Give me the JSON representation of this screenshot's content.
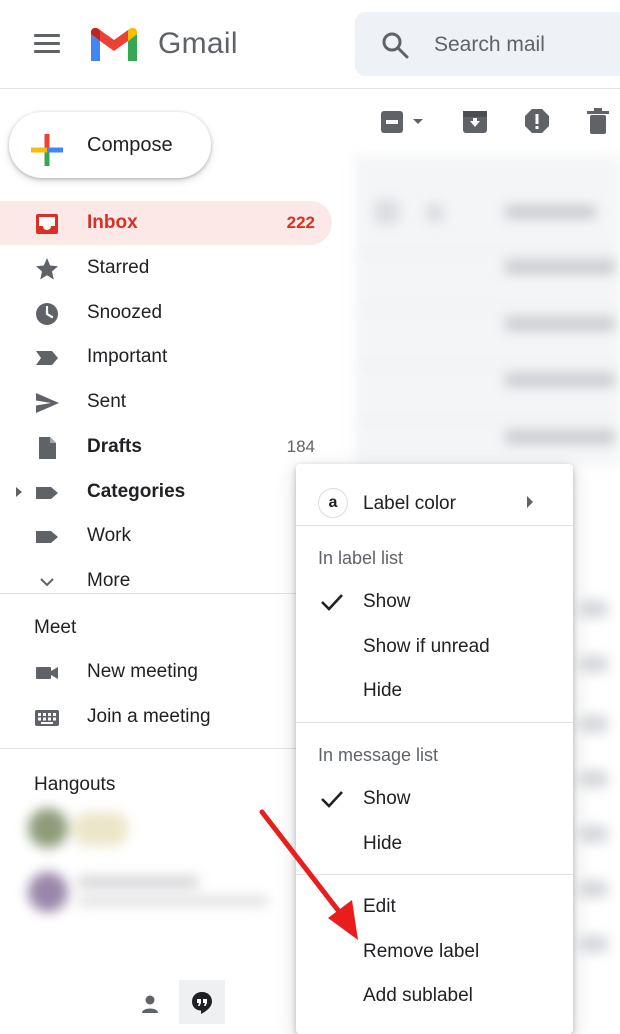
{
  "header": {
    "app_name": "Gmail",
    "search_placeholder": "Search mail"
  },
  "compose": {
    "label": "Compose"
  },
  "nav": {
    "items": [
      {
        "label": "Inbox",
        "count": "222",
        "icon": "inbox-icon",
        "active": true
      },
      {
        "label": "Starred",
        "count": "",
        "icon": "star-icon"
      },
      {
        "label": "Snoozed",
        "count": "",
        "icon": "clock-icon"
      },
      {
        "label": "Important",
        "count": "",
        "icon": "important-icon"
      },
      {
        "label": "Sent",
        "count": "",
        "icon": "send-icon"
      },
      {
        "label": "Drafts",
        "count": "184",
        "icon": "draft-icon"
      },
      {
        "label": "Categories",
        "count": "",
        "icon": "label-icon"
      },
      {
        "label": "Work",
        "count": "",
        "icon": "label-icon"
      },
      {
        "label": "More",
        "count": "",
        "icon": "chevron-down-icon"
      }
    ]
  },
  "meet": {
    "title": "Meet",
    "items": [
      {
        "label": "New meeting",
        "icon": "video-icon"
      },
      {
        "label": "Join a meeting",
        "icon": "keyboard-icon"
      }
    ]
  },
  "hangouts": {
    "title": "Hangouts"
  },
  "context_menu": {
    "label_color": "Label color",
    "swatch_letter": "a",
    "in_label_list_header": "In label list",
    "label_list_options": [
      "Show",
      "Show if unread",
      "Hide"
    ],
    "in_message_list_header": "In message list",
    "message_list_options": [
      "Show",
      "Hide"
    ],
    "actions": [
      "Edit",
      "Remove label",
      "Add sublabel"
    ]
  },
  "colors": {
    "accent_red": "#d93025",
    "active_bg": "#fce8e6",
    "arrow_red": "#ea1d1d"
  }
}
